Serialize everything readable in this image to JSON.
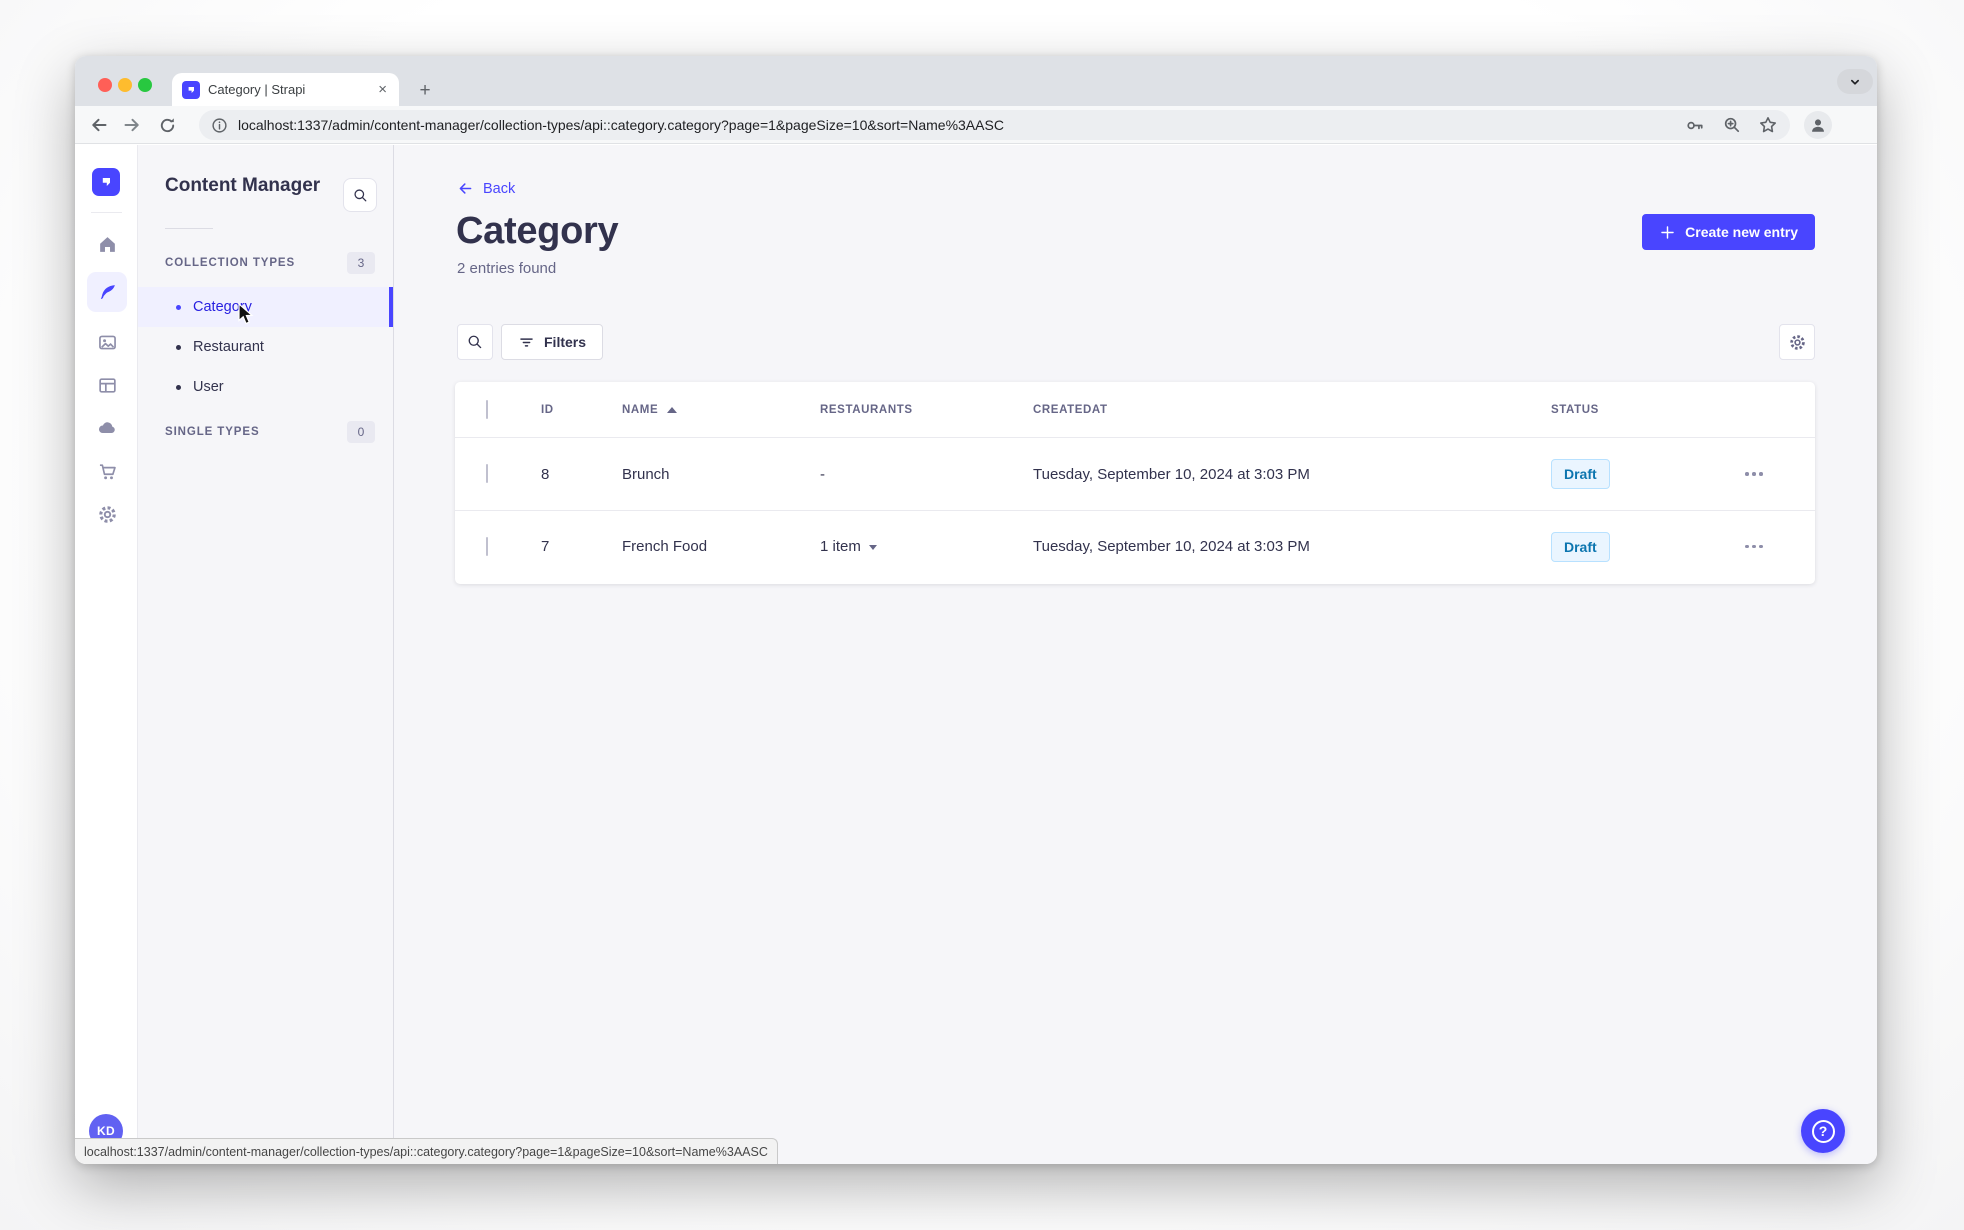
{
  "browser": {
    "tab_title": "Category | Strapi",
    "tab_close_glyph": "×",
    "new_tab_glyph": "+",
    "url": "localhost:1337/admin/content-manager/collection-types/api::category.category?page=1&pageSize=10&sort=Name%3AASC",
    "status_bar_url": "localhost:1337/admin/content-manager/collection-types/api::category.category?page=1&pageSize=10&sort=Name%3AASC"
  },
  "rail": {
    "icons": [
      "strapi-logo",
      "home",
      "content-manager-feather",
      "media-library",
      "content-type-builder",
      "deploy-cloud",
      "marketplace-cart",
      "settings-gear"
    ],
    "avatar_initials": "KD"
  },
  "subnav": {
    "title": "Content Manager",
    "collection_types": {
      "label": "COLLECTION TYPES",
      "count": "3",
      "items": [
        {
          "label": "Category",
          "active": true
        },
        {
          "label": "Restaurant",
          "active": false
        },
        {
          "label": "User",
          "active": false
        }
      ]
    },
    "single_types": {
      "label": "SINGLE TYPES",
      "count": "0"
    }
  },
  "main": {
    "back_label": "Back",
    "title": "Category",
    "subtitle": "2 entries found",
    "create_button_label": "Create new entry",
    "filters_button_label": "Filters",
    "table": {
      "headers": [
        "ID",
        "NAME",
        "RESTAURANTS",
        "CREATEDAT",
        "STATUS"
      ],
      "sorted_by": "NAME",
      "sort_direction": "asc",
      "rows": [
        {
          "id": "8",
          "name": "Brunch",
          "restaurants": "-",
          "restaurants_expandable": false,
          "created_at": "Tuesday, September 10, 2024 at 3:03 PM",
          "status": "Draft"
        },
        {
          "id": "7",
          "name": "French Food",
          "restaurants": "1 item",
          "restaurants_expandable": true,
          "created_at": "Tuesday, September 10, 2024 at 3:03 PM",
          "status": "Draft"
        }
      ]
    }
  },
  "help_glyph": "?",
  "colors": {
    "accent": "#4945ff",
    "active_item_bg": "#f0f0ff",
    "active_item_text": "#271fe0",
    "heading_text": "#32324d",
    "muted_text": "#666687",
    "draft_badge_bg": "#eaf5ff",
    "draft_badge_border": "#b8e1ff",
    "draft_badge_text": "#0c75af",
    "traffic_lights": [
      "#ff5f57",
      "#febc2e",
      "#28c840"
    ]
  }
}
